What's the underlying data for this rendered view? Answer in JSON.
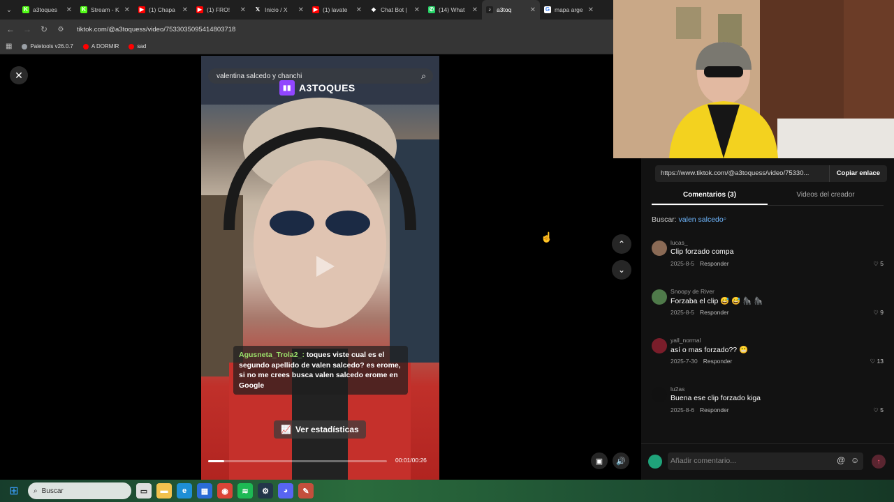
{
  "browser": {
    "tabs": [
      {
        "title": "a3toques",
        "favicon_color": "#53fc18",
        "favicon_glyph": "K",
        "active": false
      },
      {
        "title": "Stream - K",
        "favicon_color": "#53fc18",
        "favicon_glyph": "K",
        "active": false
      },
      {
        "title": "(1) Chapa",
        "favicon_color": "#ff0000",
        "favicon_glyph": "▶",
        "active": false
      },
      {
        "title": "(1) FRO!",
        "favicon_color": "#ff0000",
        "favicon_glyph": "▶",
        "active": false
      },
      {
        "title": "Inicio / X",
        "favicon_color": "#1f1f1f",
        "favicon_glyph": "𝕏",
        "active": false
      },
      {
        "title": "(1) lavate",
        "favicon_color": "#ff0000",
        "favicon_glyph": "▶",
        "active": false
      },
      {
        "title": "Chat Bot |",
        "favicon_color": "#1f1f1f",
        "favicon_glyph": "◆",
        "active": false
      },
      {
        "title": "(14) What",
        "favicon_color": "#25d366",
        "favicon_glyph": "✆",
        "active": false
      },
      {
        "title": "a3toq",
        "favicon_color": "#1f1f1f",
        "favicon_glyph": "♪",
        "active": true
      },
      {
        "title": "mapa arge",
        "favicon_color": "#ffffff",
        "favicon_glyph": "G",
        "active": false
      }
    ],
    "url": "tiktok.com/@a3toquess/video/7533035095414803718",
    "bookmarks": [
      {
        "label": "Paletools v26.0.7",
        "color": "#9aa0a6"
      },
      {
        "label": "A DORMIR",
        "color": "#ff0000"
      },
      {
        "label": "sad",
        "color": "#ff0000"
      }
    ]
  },
  "video": {
    "search_text": "valentina salcedo y chanchi",
    "channel_tag": "A3TOQUES",
    "chat_user": "Agusneta_Trola2_:",
    "chat_message": "toques viste cual es el segundo apellido de valen salcedo? es erome, si no me crees busca valen salcedo erome en Google",
    "stats_label": "Ver estadísticas",
    "time": "00:01/00:26",
    "progress": 0.09
  },
  "panel": {
    "share_url": "https://www.tiktok.com/@a3toquess/video/75330...",
    "copy_label": "Copiar enlace",
    "tabs": [
      "Comentarios (3)",
      "Videos del creador"
    ],
    "search_prefix": "Buscar:",
    "search_term": "valen salcedo",
    "comments": [
      {
        "user": "lucas_",
        "text": "Clip forzado compa",
        "date": "2025-8-5",
        "reply": "Responder",
        "likes": "5",
        "avatar_color": "#8a6a55"
      },
      {
        "user": "Snoopy de River",
        "text": "Forzaba el clip 😅 😅 🦍 🦍",
        "date": "2025-8-5",
        "reply": "Responder",
        "likes": "9",
        "avatar_color": "#4f7a4a"
      },
      {
        "user": "yall_normal",
        "text": "así o mas forzado?? 😬",
        "date": "2025-7-30",
        "reply": "Responder",
        "likes": "13",
        "avatar_color": "#7a1d2a"
      },
      {
        "user": "lu2as",
        "text": "Buena ese clip forzado kiga",
        "date": "2025-8-6",
        "reply": "Responder",
        "likes": "5",
        "avatar_color": "#111111"
      }
    ],
    "composer_placeholder": "Añadir comentario..."
  },
  "taskbar": {
    "search_label": "Buscar"
  }
}
